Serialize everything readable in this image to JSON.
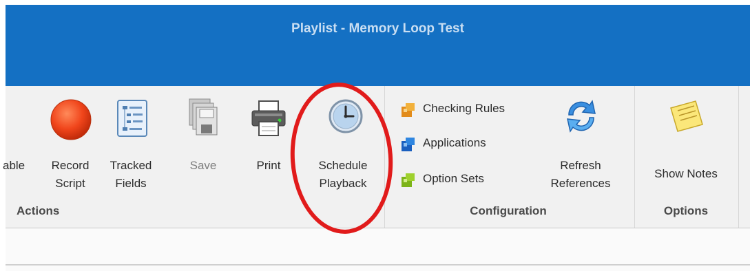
{
  "window": {
    "title": "Playlist - Memory Loop Test"
  },
  "ribbon": {
    "groups": {
      "actions": "Actions",
      "configuration": "Configuration",
      "options": "Options"
    },
    "actions": {
      "partial": "able",
      "record": [
        "Record",
        "Script"
      ],
      "tracked": [
        "Tracked",
        "Fields"
      ],
      "save": "Save",
      "print": "Print",
      "schedule": [
        "Schedule",
        "Playback"
      ]
    },
    "configuration": {
      "checking_rules": "Checking Rules",
      "applications": "Applications",
      "option_sets": "Option Sets",
      "refresh": [
        "Refresh",
        "References"
      ]
    },
    "options": {
      "show_notes": "Show Notes"
    }
  },
  "colors": {
    "titlebar": "#1470c3",
    "annotation": "#e11b1b"
  },
  "icons": {
    "record": "record-circle-icon",
    "tracked": "tree-document-icon",
    "save": "save-stack-icon",
    "print": "printer-icon",
    "schedule": "clock-icon",
    "checking_rules": "puzzle-orange-icon",
    "applications": "puzzle-blue-icon",
    "option_sets": "puzzle-green-icon",
    "refresh": "refresh-arrows-icon",
    "notes": "sticky-note-icon"
  }
}
